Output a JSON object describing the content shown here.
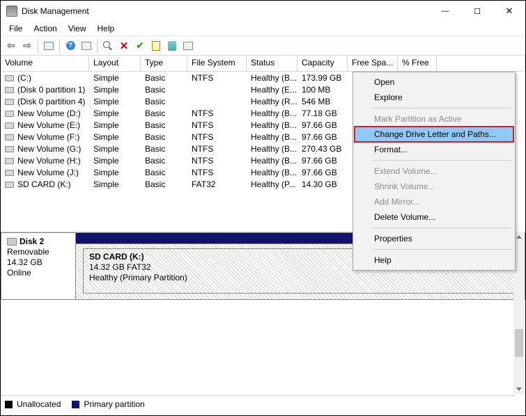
{
  "window": {
    "title": "Disk Management"
  },
  "menu": {
    "file": "File",
    "action": "Action",
    "view": "View",
    "help": "Help"
  },
  "list": {
    "headers": {
      "volume": "Volume",
      "layout": "Layout",
      "type": "Type",
      "fs": "File System",
      "status": "Status",
      "capacity": "Capacity",
      "free": "Free Spa...",
      "pct": "% Free"
    },
    "rows": [
      {
        "volume": "(C:)",
        "layout": "Simple",
        "type": "Basic",
        "fs": "NTFS",
        "status": "Healthy (B...",
        "capacity": "173.99 GB"
      },
      {
        "volume": "(Disk 0 partition 1)",
        "layout": "Simple",
        "type": "Basic",
        "fs": "",
        "status": "Healthy (E...",
        "capacity": "100 MB"
      },
      {
        "volume": "(Disk 0 partition 4)",
        "layout": "Simple",
        "type": "Basic",
        "fs": "",
        "status": "Healthy (R...",
        "capacity": "546 MB"
      },
      {
        "volume": "New Volume (D:)",
        "layout": "Simple",
        "type": "Basic",
        "fs": "NTFS",
        "status": "Healthy (B...",
        "capacity": "77.18 GB"
      },
      {
        "volume": "New Volume (E:)",
        "layout": "Simple",
        "type": "Basic",
        "fs": "NTFS",
        "status": "Healthy (B...",
        "capacity": "97.66 GB"
      },
      {
        "volume": "New Volume (F:)",
        "layout": "Simple",
        "type": "Basic",
        "fs": "NTFS",
        "status": "Healthy (B...",
        "capacity": "97.66 GB"
      },
      {
        "volume": "New Volume (G:)",
        "layout": "Simple",
        "type": "Basic",
        "fs": "NTFS",
        "status": "Healthy (B...",
        "capacity": "270.43 GB"
      },
      {
        "volume": "New Volume (H:)",
        "layout": "Simple",
        "type": "Basic",
        "fs": "NTFS",
        "status": "Healthy (B...",
        "capacity": "97.66 GB"
      },
      {
        "volume": "New Volume (J:)",
        "layout": "Simple",
        "type": "Basic",
        "fs": "NTFS",
        "status": "Healthy (B...",
        "capacity": "97.66 GB"
      },
      {
        "volume": "SD CARD (K:)",
        "layout": "Simple",
        "type": "Basic",
        "fs": "FAT32",
        "status": "Healthy (P...",
        "capacity": "14.30 GB"
      }
    ]
  },
  "disk_panel": {
    "disk_label": "Disk 2",
    "disk_type": "Removable",
    "disk_size": "14.32 GB",
    "disk_status": "Online",
    "part_title": "SD CARD  (K:)",
    "part_size": "14.32 GB FAT32",
    "part_status": "Healthy (Primary Partition)"
  },
  "legend": {
    "unalloc": "Unallocated",
    "primary": "Primary partition"
  },
  "ctx": {
    "open": "Open",
    "explore": "Explore",
    "mark_active": "Mark Partition as Active",
    "change_letter": "Change Drive Letter and Paths...",
    "format": "Format...",
    "extend": "Extend Volume...",
    "shrink": "Shrink Volume...",
    "add_mirror": "Add Mirror...",
    "delete": "Delete Volume...",
    "properties": "Properties",
    "help": "Help"
  }
}
